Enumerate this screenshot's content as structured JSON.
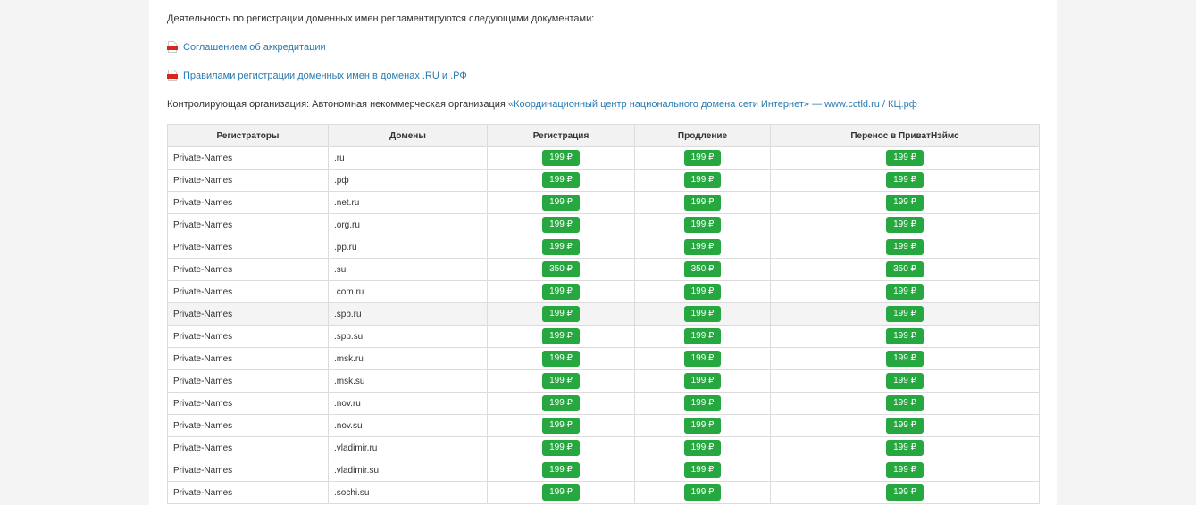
{
  "intro_text": "Деятельность по регистрации доменных имен регламентируются следующими документами:",
  "documents": [
    {
      "label": "Соглашением об аккредитации",
      "icon": "pdf-icon"
    },
    {
      "label": "Правилами регистрации доменных имен в доменах .RU и .РФ",
      "icon": "pdf-icon"
    }
  ],
  "control_org": {
    "prefix": "Контролирующая организация: Автономная некоммерческая организация ",
    "link": "«Координационный центр национального домена сети Интернет» — www.cctld.ru / КЦ.рф"
  },
  "table": {
    "headers": [
      "Регистраторы",
      "Домены",
      "Регистрация",
      "Продление",
      "Перенос в ПриватНэймс"
    ],
    "rows": [
      {
        "registrar": "Private-Names",
        "domain": ".ru",
        "registration": "199 ₽",
        "renewal": "199 ₽",
        "transfer": "199 ₽"
      },
      {
        "registrar": "Private-Names",
        "domain": ".рф",
        "registration": "199 ₽",
        "renewal": "199 ₽",
        "transfer": "199 ₽"
      },
      {
        "registrar": "Private-Names",
        "domain": ".net.ru",
        "registration": "199 ₽",
        "renewal": "199 ₽",
        "transfer": "199 ₽"
      },
      {
        "registrar": "Private-Names",
        "domain": ".org.ru",
        "registration": "199 ₽",
        "renewal": "199 ₽",
        "transfer": "199 ₽"
      },
      {
        "registrar": "Private-Names",
        "domain": ".pp.ru",
        "registration": "199 ₽",
        "renewal": "199 ₽",
        "transfer": "199 ₽"
      },
      {
        "registrar": "Private-Names",
        "domain": ".su",
        "registration": "350 ₽",
        "renewal": "350 ₽",
        "transfer": "350 ₽"
      },
      {
        "registrar": "Private-Names",
        "domain": ".com.ru",
        "registration": "199 ₽",
        "renewal": "199 ₽",
        "transfer": "199 ₽"
      },
      {
        "registrar": "Private-Names",
        "domain": ".spb.ru",
        "registration": "199 ₽",
        "renewal": "199 ₽",
        "transfer": "199 ₽"
      },
      {
        "registrar": "Private-Names",
        "domain": ".spb.su",
        "registration": "199 ₽",
        "renewal": "199 ₽",
        "transfer": "199 ₽"
      },
      {
        "registrar": "Private-Names",
        "domain": ".msk.ru",
        "registration": "199 ₽",
        "renewal": "199 ₽",
        "transfer": "199 ₽"
      },
      {
        "registrar": "Private-Names",
        "domain": ".msk.su",
        "registration": "199 ₽",
        "renewal": "199 ₽",
        "transfer": "199 ₽"
      },
      {
        "registrar": "Private-Names",
        "domain": ".nov.ru",
        "registration": "199 ₽",
        "renewal": "199 ₽",
        "transfer": "199 ₽"
      },
      {
        "registrar": "Private-Names",
        "domain": ".nov.su",
        "registration": "199 ₽",
        "renewal": "199 ₽",
        "transfer": "199 ₽"
      },
      {
        "registrar": "Private-Names",
        "domain": ".vladimir.ru",
        "registration": "199 ₽",
        "renewal": "199 ₽",
        "transfer": "199 ₽"
      },
      {
        "registrar": "Private-Names",
        "domain": ".vladimir.su",
        "registration": "199 ₽",
        "renewal": "199 ₽",
        "transfer": "199 ₽"
      },
      {
        "registrar": "Private-Names",
        "domain": ".sochi.su",
        "registration": "199 ₽",
        "renewal": "199 ₽",
        "transfer": "199 ₽"
      }
    ],
    "highlighted_row": 7
  },
  "colors": {
    "price_badge": "#26a73f",
    "link": "#2a7ab0",
    "pdf_icon": "#d7261e"
  }
}
